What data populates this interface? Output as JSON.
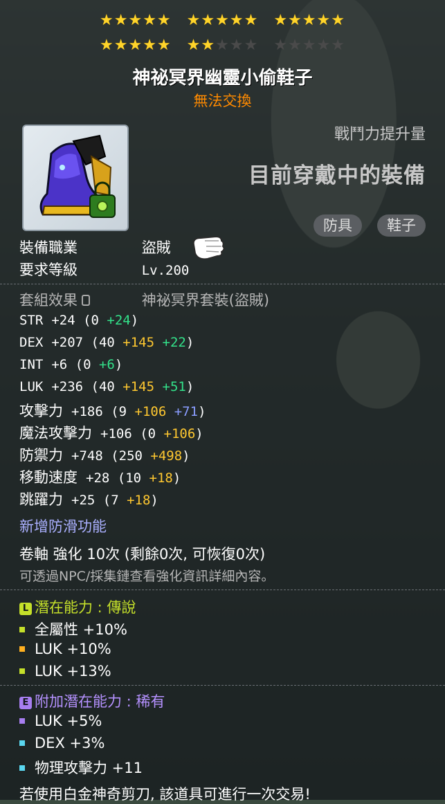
{
  "stars": {
    "rows": [
      [
        5,
        5,
        5
      ],
      [
        5,
        2,
        0
      ]
    ],
    "per_group": 5,
    "on_color": "#ffd42a",
    "off_color": "#4a4a4a",
    "filled_total": 22,
    "max_total": 30
  },
  "item": {
    "name": "神祕冥界幽靈小偷鞋子",
    "trade_status": "無法交換",
    "icon": "purple-ghost-thief-shoes-icon"
  },
  "header_right": {
    "boost_label": "戰鬥力提升量",
    "equipped_text": "目前穿戴中的裝備"
  },
  "tags": [
    "防具",
    "鞋子"
  ],
  "requirements": {
    "job_label": "裝備職業",
    "job_value": "盜賊",
    "level_label": "要求等級",
    "level_value": "Lv.200"
  },
  "set": {
    "label": "套組效果",
    "value": "神祕冥界套裝(盜賊)"
  },
  "stats": [
    {
      "label": "STR",
      "total": "+24",
      "base": "(0",
      "yellow": "",
      "green": "+24",
      "blue": "",
      "close": ")"
    },
    {
      "label": "DEX",
      "total": "+207",
      "base": "(40",
      "yellow": "+145",
      "green": "+22",
      "blue": "",
      "close": ")"
    },
    {
      "label": "INT",
      "total": "+6",
      "base": "(0",
      "yellow": "",
      "green": "+6",
      "blue": "",
      "close": ")"
    },
    {
      "label": "LUK",
      "total": "+236",
      "base": "(40",
      "yellow": "+145",
      "green": "+51",
      "blue": "",
      "close": ")"
    },
    {
      "label": "攻擊力",
      "total": "+186",
      "base": "(9",
      "yellow": "+106",
      "green": "",
      "blue": "+71",
      "close": ")"
    },
    {
      "label": "魔法攻擊力",
      "total": "+106",
      "base": "(0",
      "yellow": "+106",
      "green": "",
      "blue": "",
      "close": ")"
    },
    {
      "label": "防禦力",
      "total": "+748",
      "base": "(250",
      "yellow": "+498",
      "green": "",
      "blue": "",
      "close": ")"
    },
    {
      "label": "移動速度",
      "total": "+28",
      "base": "(10",
      "yellow": "+18",
      "green": "",
      "blue": "",
      "close": ")"
    },
    {
      "label": "跳躍力",
      "total": "+25",
      "base": "(7",
      "yellow": "+18",
      "green": "",
      "blue": "",
      "close": ")"
    }
  ],
  "anti_slip": "新增防滑功能",
  "scroll": {
    "text": "卷軸 強化 10次 (剩餘0次, 可恢復0次)",
    "hint": "可透過NPC/採集鏈查看強化資訊詳細內容。"
  },
  "potential": {
    "badge": "L",
    "badge_color": "#c5e02a",
    "title": "潛在能力 : 傳說",
    "lines": [
      {
        "text": "全屬性 +10%",
        "color": "#c5e02a"
      },
      {
        "text": "LUK +10%",
        "color": "#ffb020"
      },
      {
        "text": "LUK +13%",
        "color": "#c5e02a"
      }
    ]
  },
  "additional": {
    "badge": "E",
    "badge_color": "#a77ef0",
    "title": "附加潛在能力 : 稀有",
    "lines": [
      {
        "text": "LUK +5%",
        "color": "#a77ef0"
      },
      {
        "text": "DEX +3%",
        "color": "#5ad7f0"
      },
      {
        "text": "物理攻擊力 +11",
        "color": "#5ad7f0"
      }
    ]
  },
  "footer": "若使用白金神奇剪刀, 該道具可進行一次交易!"
}
